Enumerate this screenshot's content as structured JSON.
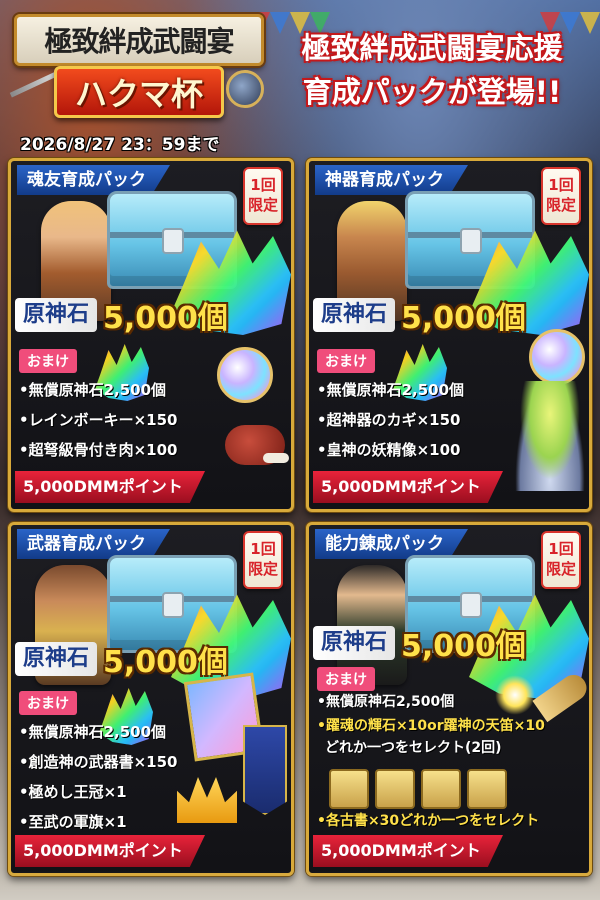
{
  "header": {
    "logo_title": "極致絆成武闘宴",
    "logo_subtitle": "ハクマ杯",
    "headline_line1": "極致絆成武闘宴応援",
    "headline_line2": "育成パックが登場!!",
    "deadline": "2026/8/27 23：59まで"
  },
  "packs": [
    {
      "title": "魂友育成パック",
      "limited": "1回限定",
      "stone_label": "原神石",
      "stone_amount": "5,000個",
      "bonus_tag": "おまけ",
      "items": [
        "•無償原神石2,500個",
        "•レインボーキー×150",
        "•超弩級骨付き肉×100"
      ],
      "price": "5,000DMMポイント"
    },
    {
      "title": "神器育成パック",
      "limited": "1回限定",
      "stone_label": "原神石",
      "stone_amount": "5,000個",
      "bonus_tag": "おまけ",
      "items": [
        "•無償原神石2,500個",
        "•超神器のカギ×150",
        "•皇神の妖精像×100"
      ],
      "price": "5,000DMMポイント"
    },
    {
      "title": "武器育成パック",
      "limited": "1回限定",
      "stone_label": "原神石",
      "stone_amount": "5,000個",
      "bonus_tag": "おまけ",
      "items": [
        "•無償原神石2,500個",
        "•創造神の武器書×150",
        "•極めし王冠×1",
        "•至武の軍旗×1"
      ],
      "price": "5,000DMMポイント"
    },
    {
      "title": "能力錬成パック",
      "limited": "1回限定",
      "stone_label": "原神石",
      "stone_amount": "5,000個",
      "bonus_tag": "おまけ",
      "items": [
        "•無償原神石2,500個",
        "•躍魂の輝石×10or躍神の天笛×10",
        "どれか一つをセレクト(2回)",
        "•各古書×30どれか一つをセレクト"
      ],
      "price": "5,000DMMポイント"
    }
  ]
}
